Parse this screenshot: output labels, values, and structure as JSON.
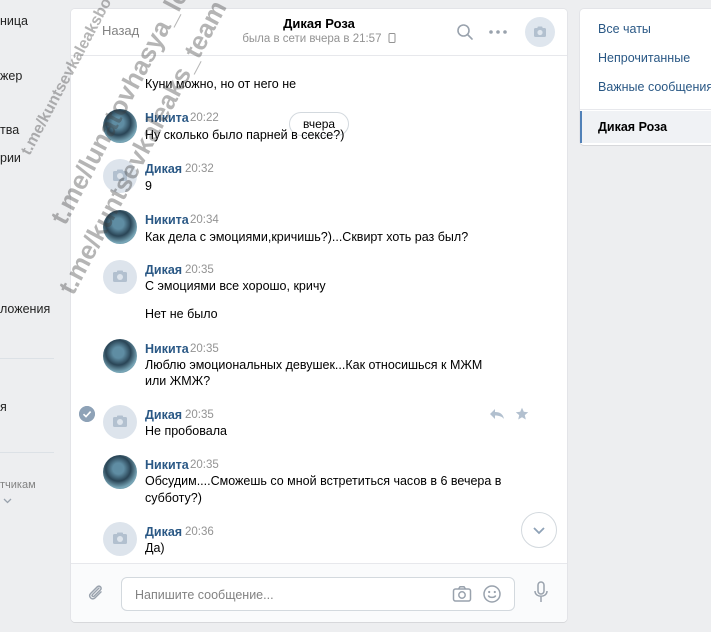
{
  "left_nav": {
    "items": [
      "ница",
      "жер",
      "тва",
      "рии",
      "ложения",
      "я",
      "тчикам"
    ],
    "chevron": "chevron-down-icon"
  },
  "chat": {
    "back_label": "Назад",
    "title": "Дикая Роза",
    "status": "была в сети вчера в 21:57",
    "date_divider": "вчера",
    "messages": [
      {
        "author": "",
        "time": "",
        "lines": [
          "Куни можно, но от него не"
        ]
      },
      {
        "author": "Никита",
        "time": "20:22",
        "lines": [
          "Ну сколько было парней в сексе?)"
        ]
      },
      {
        "author": "Дикая",
        "time": "20:32",
        "lines": [
          "9"
        ]
      },
      {
        "author": "Никита",
        "time": "20:34",
        "lines": [
          "Как дела с эмоциями,кричишь?)...Сквирт хоть раз был?"
        ]
      },
      {
        "author": "Дикая",
        "time": "20:35",
        "lines": [
          "С эмоциями все хорошо, кричу",
          "Нет не было"
        ]
      },
      {
        "author": "Никита",
        "time": "20:35",
        "lines": [
          "Люблю эмоциональных девушек...Как относишься к МЖМ",
          "или ЖМЖ?"
        ]
      },
      {
        "author": "Дикая",
        "time": "20:35",
        "lines": [
          "Не пробовала"
        ]
      },
      {
        "author": "Никита",
        "time": "20:35",
        "lines": [
          "Обсудим....Сможешь со мной встретиться часов в 6 вечера в",
          "субботу?)"
        ]
      },
      {
        "author": "Дикая",
        "time": "20:36",
        "lines": [
          "Да)"
        ]
      }
    ],
    "composer_placeholder": "Напишите сообщение..."
  },
  "right_menu": {
    "items": [
      "Все чаты",
      "Непрочитанные",
      "Важные сообщения"
    ],
    "active": "Дикая Роза"
  },
  "watermark": [
    "t.me/kuntsevkaleaksbot",
    "t.me/lunatovhasya_leaks",
    "t.me/kuntsevkaleaks_team"
  ],
  "colors": {
    "link": "#2a5885",
    "accent": "#5181b8",
    "background": "#edeef0",
    "muted": "#939393"
  }
}
